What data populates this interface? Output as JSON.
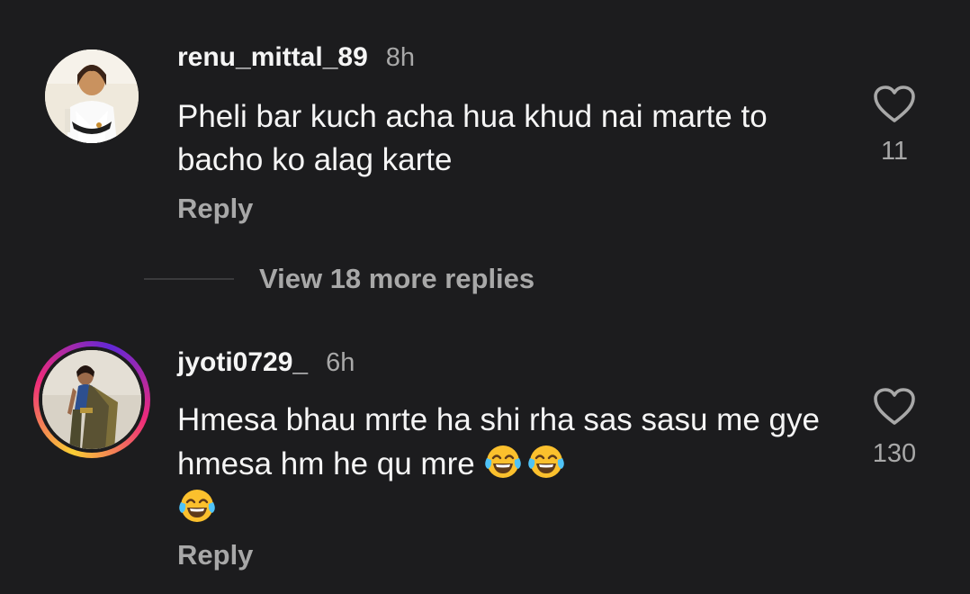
{
  "comments": [
    {
      "username": "renu_mittal_89",
      "time": "8h",
      "text": "Pheli bar kuch acha hua khud nai marte to bacho ko alag karte",
      "likes": "11",
      "reply_label": "Reply",
      "avatar": "profile-photo-woman-white-outfit",
      "has_story_ring": false
    },
    {
      "username": "jyoti0729_",
      "time": "6h",
      "text": "Hmesa bhau mrte ha shi rha sas sasu me gye hmesa hm he qu mre",
      "emojis": [
        "face-with-tears-of-joy",
        "face-with-tears-of-joy",
        "face-with-tears-of-joy"
      ],
      "likes": "130",
      "reply_label": "Reply",
      "avatar": "profile-photo-woman-saree",
      "has_story_ring": true
    }
  ],
  "view_more_replies": "View 18 more replies",
  "colors": {
    "background": "#1c1c1e",
    "primary_text": "#f5f5f5",
    "secondary_text": "#a8a8a8",
    "story_ring": [
      "#f9ce34",
      "#ee2a7b",
      "#6228d7"
    ]
  },
  "icons": {
    "like": "heart-outline-icon",
    "emoji": "laughing-crying-emoji"
  }
}
